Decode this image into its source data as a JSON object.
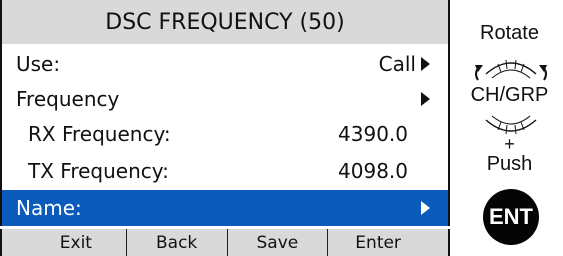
{
  "screen": {
    "title": "DSC FREQUENCY (50)",
    "menu": [
      {
        "label": "Use:",
        "value": "Call"
      },
      {
        "label": "Frequency",
        "value": ""
      },
      {
        "label": "RX Frequency:",
        "value": "4390.0"
      },
      {
        "label": "TX Frequency:",
        "value": "4098.0"
      },
      {
        "label": "Name:",
        "value": ""
      }
    ],
    "selected_item": "Name:",
    "softkeys": [
      "Exit",
      "Back",
      "Save",
      "Enter"
    ]
  },
  "instructions": {
    "rotate": "Rotate",
    "dial": "CH/GRP",
    "plus": "+",
    "push": "Push",
    "ent_key": "ENT"
  },
  "colors": {
    "title_bar": "#d9d9d9",
    "selection": "#0b5bbd",
    "softkey_bar": "#d9d9d9"
  },
  "icons": [
    "right-arrow-icon",
    "rotate-knob-icon",
    "ent-button-icon"
  ]
}
